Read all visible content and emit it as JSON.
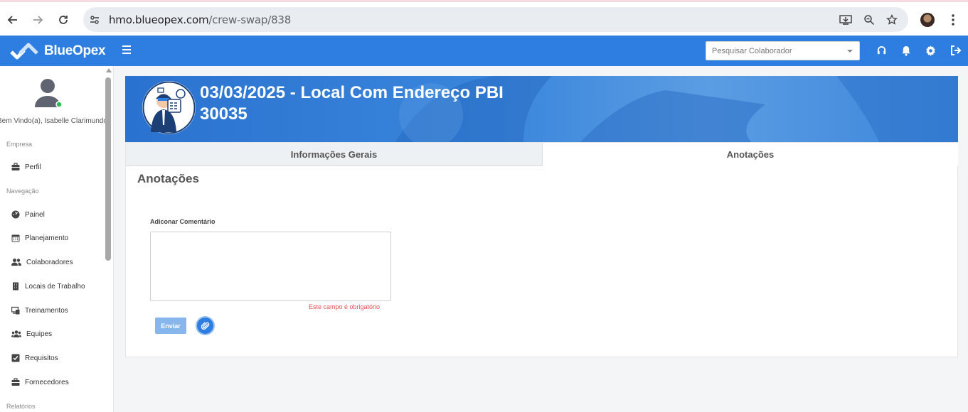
{
  "browser": {
    "url_host": "hmo.blueopex.com",
    "url_path": "/crew-swap/838"
  },
  "header": {
    "app_name": "BlueOpex",
    "search_placeholder": "Pesquisar Colaborador"
  },
  "sidebar": {
    "welcome": "Bem Vindo(a), Isabelle Clarimundo",
    "sections": [
      {
        "label": "Empresa",
        "items": [
          {
            "label": "Perfil",
            "icon": "briefcase-icon"
          }
        ]
      },
      {
        "label": "Navegação",
        "items": [
          {
            "label": "Painel",
            "icon": "dashboard-icon"
          },
          {
            "label": "Planejamento",
            "icon": "calendar-icon"
          },
          {
            "label": "Colaboradores",
            "icon": "users-icon"
          },
          {
            "label": "Locais de Trabalho",
            "icon": "building-icon"
          },
          {
            "label": "Treinamentos",
            "icon": "training-icon"
          },
          {
            "label": "Equipes",
            "icon": "team-icon"
          },
          {
            "label": "Requisitos",
            "icon": "checkbox-icon"
          },
          {
            "label": "Fornecedores",
            "icon": "briefcase-icon"
          }
        ]
      },
      {
        "label": "Relatórios",
        "items": []
      }
    ]
  },
  "banner": {
    "title": "03/03/2025 - Local Com Endereço PBI 30035"
  },
  "tabs": [
    {
      "label": "Informações Gerais",
      "active": false
    },
    {
      "label": "Anotações",
      "active": true
    }
  ],
  "notes": {
    "section_title": "Anotações",
    "field_label": "Adiconar Comentário",
    "comment_value": "",
    "error_text": "Este campo é obrigatório",
    "send_label": "Enviar"
  },
  "colors": {
    "brand_blue": "#2d7ee0",
    "error_red": "#e25050"
  }
}
